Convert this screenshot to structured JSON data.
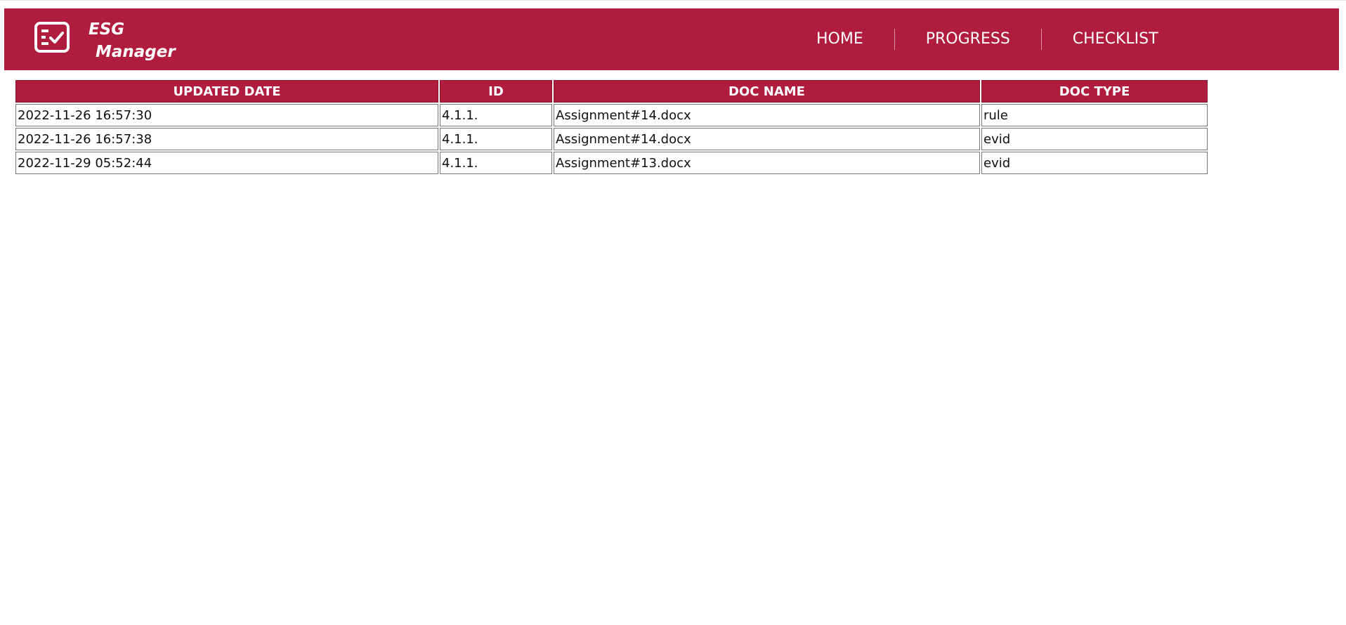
{
  "header": {
    "brand_line1": "ESG",
    "brand_line2": "Manager",
    "logo_icon": "checklist-icon",
    "background_color": "#b01c3e",
    "nav": [
      "HOME",
      "PROGRESS",
      "CHECKLIST"
    ]
  },
  "table": {
    "columns": [
      "UPDATED DATE",
      "ID",
      "DOC NAME",
      "DOC TYPE"
    ],
    "rows": [
      [
        "2022-11-26 16:57:30",
        "4.1.1.",
        "Assignment#14.docx",
        "rule"
      ],
      [
        "2022-11-26 16:57:38",
        "4.1.1.",
        "Assignment#14.docx",
        "evid"
      ],
      [
        "2022-11-29 05:52:44",
        "4.1.1.",
        "Assignment#13.docx",
        "evid"
      ]
    ]
  }
}
